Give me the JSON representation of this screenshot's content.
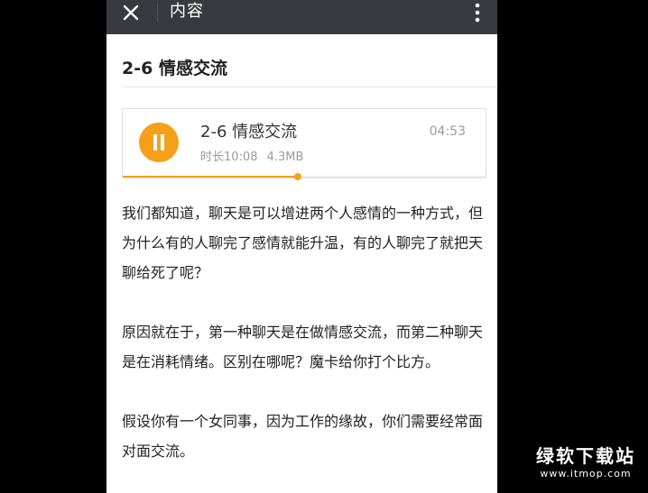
{
  "topbar": {
    "title": "内容",
    "close_icon": "close-icon",
    "menu_icon": "more-vertical-icon",
    "background": "#393a3f"
  },
  "article": {
    "title": "2-6 情感交流",
    "paragraphs": [
      "我们都知道，聊天是可以增进两个人感情的一种方式，但为什么有的人聊完了感情就能升温，有的人聊完了就把天聊给死了呢？",
      "原因就在于，第一种聊天是在做情感交流，而第二种聊天是在消耗情绪。区别在哪呢？魔卡给你打个比方。",
      "假设你有一个女同事，因为工作的缘故，你们需要经常面对面交流。"
    ]
  },
  "audio": {
    "title": "2-6 情感交流",
    "duration_label": "时长10:08",
    "size": "4.3MB",
    "current_time": "04:53",
    "progress_fraction": 0.482,
    "accent": "#f5a01a",
    "state_icon": "pause-icon"
  },
  "watermark": {
    "main": "绿软下载站",
    "sub": "www.itmop.com"
  }
}
